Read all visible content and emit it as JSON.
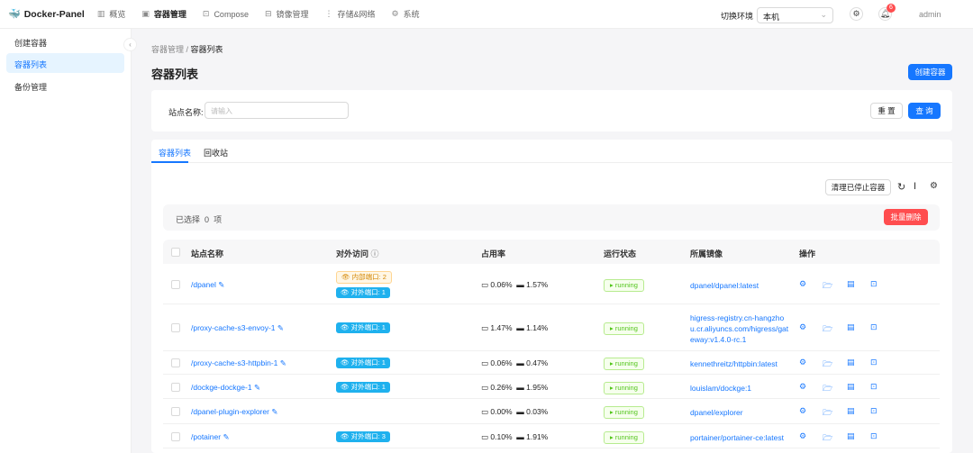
{
  "header": {
    "brand": "Docker-Panel",
    "nav": [
      {
        "label": "概览",
        "icon": "chart-icon"
      },
      {
        "label": "容器管理",
        "icon": "container-icon",
        "active": true
      },
      {
        "label": "Compose",
        "icon": "compose-icon"
      },
      {
        "label": "镜像管理",
        "icon": "image-icon"
      },
      {
        "label": "存储&网络",
        "icon": "storage-icon"
      },
      {
        "label": "系统",
        "icon": "gear-icon"
      }
    ],
    "env_label": "切换环境",
    "env_value": "本机",
    "notifications": "6",
    "user": "admin"
  },
  "sidebar": {
    "items": [
      {
        "label": "创建容器"
      },
      {
        "label": "容器列表",
        "active": true
      },
      {
        "label": "备份管理"
      }
    ]
  },
  "breadcrumb": {
    "parent": "容器管理",
    "current": "容器列表"
  },
  "page_title": "容器列表",
  "create_button": "创建容器",
  "search": {
    "label": "站点名称:",
    "placeholder": "请输入",
    "reset": "重 置",
    "query": "查 询"
  },
  "tabs": [
    {
      "label": "容器列表"
    },
    {
      "label": "回收站"
    }
  ],
  "toolbar": {
    "clean": "清理已停止容器"
  },
  "selection": {
    "text": "已选择",
    "count": "0",
    "unit": "项",
    "batch_delete": "批量删除"
  },
  "columns": [
    "站点名称",
    "对外访问",
    "占用率",
    "运行状态",
    "所属镜像",
    "操作"
  ],
  "rows": [
    {
      "name": "/dpanel",
      "inner": "内部端口: 2",
      "outer": "对外端口: 1",
      "cpu": "0.06%",
      "mem": "1.57%",
      "status": "running",
      "image": "dpanel/dpanel:latest"
    },
    {
      "name": "/proxy-cache-s3-envoy-1",
      "outer": "对外端口: 1",
      "cpu": "1.47%",
      "mem": "1.14%",
      "status": "running",
      "image": "higress-registry.cn-hangzhou.cr.aliyuncs.com/higress/gateway:v1.4.0-rc.1"
    },
    {
      "name": "/proxy-cache-s3-httpbin-1",
      "outer": "对外端口: 1",
      "cpu": "0.06%",
      "mem": "0.47%",
      "status": "running",
      "image": "kennethreitz/httpbin:latest"
    },
    {
      "name": "/dockge-dockge-1",
      "outer": "对外端口: 1",
      "cpu": "0.26%",
      "mem": "1.95%",
      "status": "running",
      "image": "louislam/dockge:1"
    },
    {
      "name": "/dpanel-plugin-explorer",
      "cpu": "0.00%",
      "mem": "0.03%",
      "status": "running",
      "image": "dpanel/explorer"
    },
    {
      "name": "/potainer",
      "outer": "对外端口: 3",
      "cpu": "0.10%",
      "mem": "1.91%",
      "status": "running",
      "image": "portainer/portainer-ce:latest"
    }
  ]
}
